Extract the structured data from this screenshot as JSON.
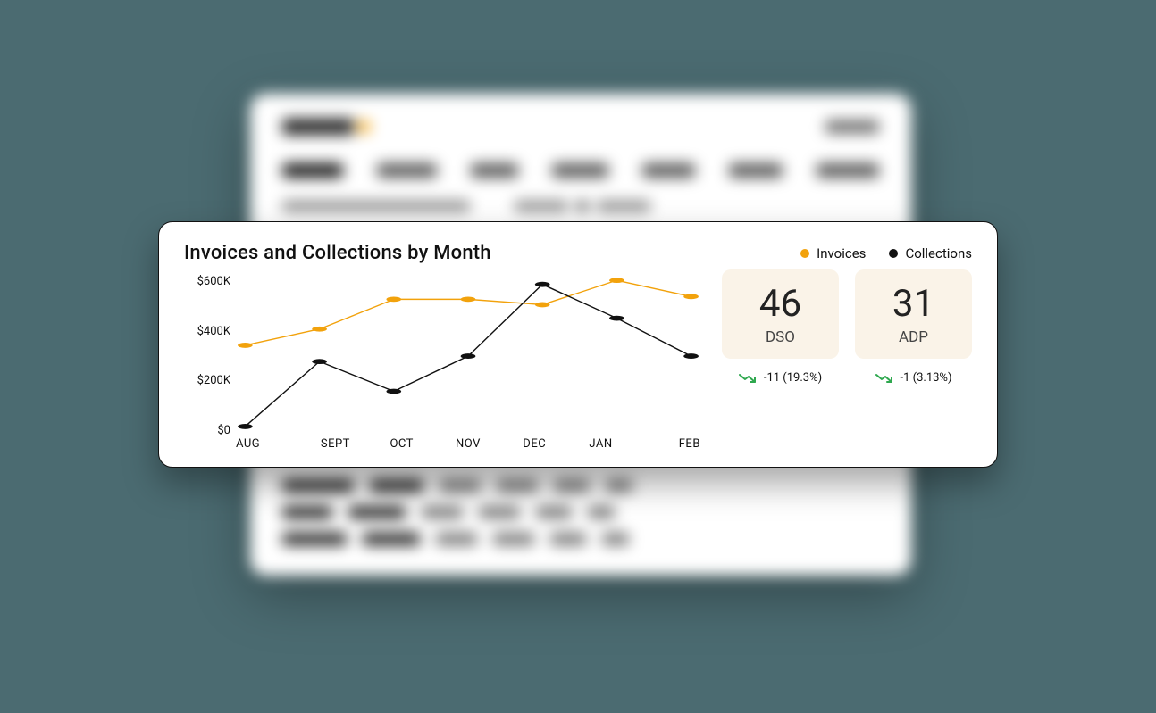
{
  "bg_nav": {
    "tabs": [
      "Dashboard",
      "Customers",
      "Invoices",
      "Payments",
      "Activities",
      "Requests",
      "Documents"
    ]
  },
  "title": "Invoices and Collections by Month",
  "legend": {
    "invoices": "Invoices",
    "collections": "Collections"
  },
  "colors": {
    "invoices": "#f2a20c",
    "collections": "#111111",
    "kpi_bg": "#faf3e8",
    "trend_down": "#2fa84f"
  },
  "chart_data": {
    "type": "line",
    "title": "Invoices and Collections by Month",
    "xlabel": "",
    "ylabel": "",
    "ylim": [
      0,
      600000
    ],
    "y_ticks": [
      "$600K",
      "$400K",
      "$200K",
      "$0"
    ],
    "categories": [
      "AUG",
      "SEPT",
      "OCT",
      "NOV",
      "DEC",
      "JAN",
      "FEB"
    ],
    "series": [
      {
        "name": "Invoices",
        "color": "#f2a20c",
        "values": [
          320000,
          380000,
          490000,
          490000,
          470000,
          560000,
          500000
        ]
      },
      {
        "name": "Collections",
        "color": "#111111",
        "values": [
          20000,
          260000,
          150000,
          280000,
          545000,
          420000,
          280000
        ]
      }
    ],
    "legend_position": "top-right",
    "grid": false
  },
  "kpis": [
    {
      "value": "46",
      "label": "DSO",
      "delta_text": "-11 (19.3%)",
      "trend": "down"
    },
    {
      "value": "31",
      "label": "ADP",
      "delta_text": "-1 (3.13%)",
      "trend": "down"
    }
  ]
}
